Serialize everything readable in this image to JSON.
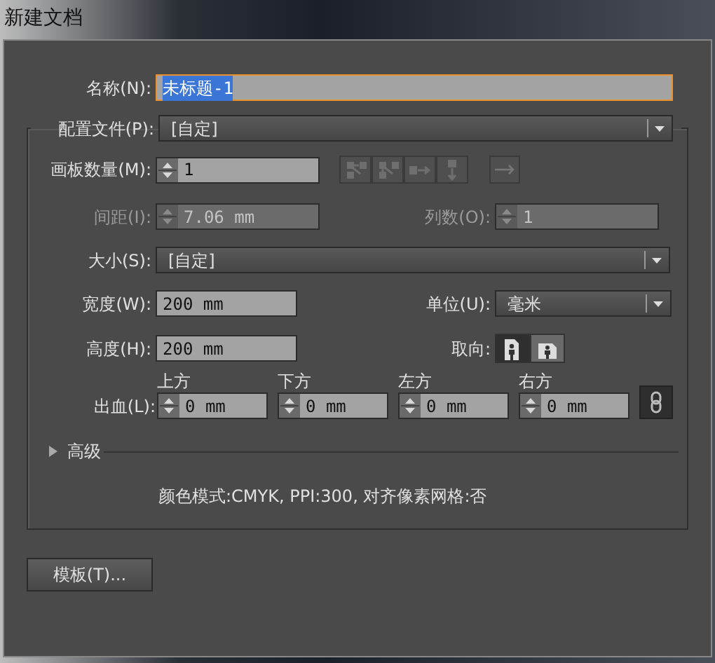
{
  "window": {
    "title": "新建文档"
  },
  "name": {
    "label": "名称(N):",
    "value": "未标题-1",
    "focused": true
  },
  "profile": {
    "label": "配置文件(P):",
    "value": "[自定]"
  },
  "artboards": {
    "label": "画板数量(M):",
    "value": "1",
    "layout_buttons": [
      {
        "kind": "grid-row",
        "disabled": true
      },
      {
        "kind": "grid-column",
        "disabled": true
      },
      {
        "kind": "row",
        "disabled": true
      },
      {
        "kind": "column",
        "disabled": true
      }
    ],
    "direction_button": {
      "disabled": true
    }
  },
  "spacing": {
    "label": "间距(I):",
    "value": "7.06 mm",
    "disabled": true
  },
  "columns": {
    "label": "列数(O):",
    "value": "1",
    "disabled": true
  },
  "size": {
    "label": "大小(S):",
    "value": "[自定]"
  },
  "width": {
    "label": "宽度(W):",
    "value": "200 mm"
  },
  "units": {
    "label": "单位(U):",
    "value": "毫米"
  },
  "height": {
    "label": "高度(H):",
    "value": "200 mm"
  },
  "orientation": {
    "label": "取向:",
    "options": [
      {
        "kind": "portrait",
        "selected": true
      },
      {
        "kind": "landscape",
        "selected": false
      }
    ]
  },
  "bleed": {
    "label": "出血(L):",
    "fields": [
      {
        "label": "上方",
        "value": "0 mm"
      },
      {
        "label": "下方",
        "value": "0 mm"
      },
      {
        "label": "左方",
        "value": "0 mm"
      },
      {
        "label": "右方",
        "value": "0 mm"
      }
    ]
  },
  "advanced": {
    "label": "高级",
    "expanded": false
  },
  "summary": "颜色模式:CMYK, PPI:300, 对齐像素网格:否",
  "template_button": "模板(T)..."
}
